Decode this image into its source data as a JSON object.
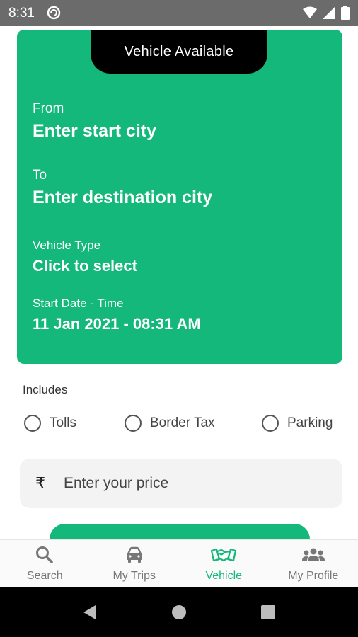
{
  "status_bar": {
    "time": "8:31"
  },
  "card": {
    "tab_label": "Vehicle Available",
    "from": {
      "label": "From",
      "value": "Enter start city"
    },
    "to": {
      "label": "To",
      "value": "Enter destination city"
    },
    "vehicle_type": {
      "label": "Vehicle Type",
      "value": "Click to select"
    },
    "start_date": {
      "label": "Start Date - Time",
      "value": "11 Jan 2021 - 08:31 AM"
    }
  },
  "includes": {
    "label": "Includes",
    "options": [
      "Tolls",
      "Border Tax",
      "Parking"
    ]
  },
  "price": {
    "currency_symbol": "₹",
    "placeholder": "Enter your price"
  },
  "bottom_nav": {
    "items": [
      {
        "label": "Search",
        "icon": "search-icon"
      },
      {
        "label": "My Trips",
        "icon": "car-icon"
      },
      {
        "label": "Vehicle",
        "icon": "handshake-icon",
        "active": true
      },
      {
        "label": "My Profile",
        "icon": "users-icon"
      }
    ]
  },
  "colors": {
    "accent": "#14b87a",
    "tab_bg": "#000000"
  }
}
